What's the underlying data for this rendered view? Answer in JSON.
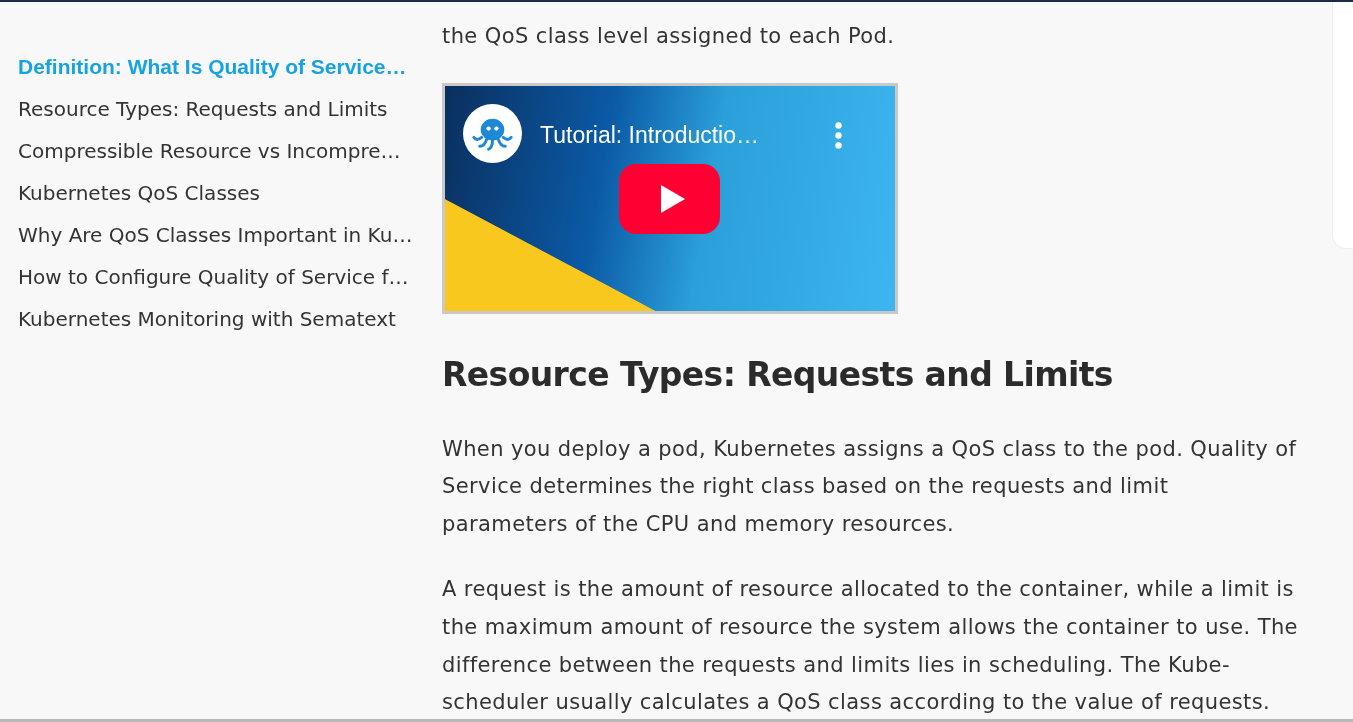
{
  "sidebar": {
    "items": [
      {
        "label": "Definition: What Is Quality of Service…",
        "selected": true
      },
      {
        "label": "Resource Types: Requests and Limits",
        "selected": false
      },
      {
        "label": "Compressible Resource vs Incompre…",
        "selected": false
      },
      {
        "label": "Kubernetes QoS Classes",
        "selected": false
      },
      {
        "label": "Why Are QoS Classes Important in Ku…",
        "selected": false
      },
      {
        "label": "How to Configure Quality of Service f…",
        "selected": false
      },
      {
        "label": "Kubernetes Monitoring with Sematext",
        "selected": false
      }
    ]
  },
  "article": {
    "blocks": [
      {
        "kind": "paragraph",
        "text": "the QoS class level assigned to each Pod."
      },
      {
        "kind": "video",
        "title": "Tutorial: Introductio…"
      },
      {
        "kind": "heading",
        "text": "Resource Types: Requests and Limits"
      },
      {
        "kind": "paragraph",
        "text": "When you deploy a pod, Kubernetes assigns a QoS class to the pod. Quality of Service determines the right class based on the requests and limit parameters of the CPU and memory resources."
      },
      {
        "kind": "paragraph",
        "text": "A request is the amount of resource allocated to the container, while a limit is the maximum amount of resource the system allows the container to use. The difference between the requests and limits lies in scheduling. The Kube-scheduler usually calculates a QoS class according to the value of requests."
      }
    ]
  }
}
